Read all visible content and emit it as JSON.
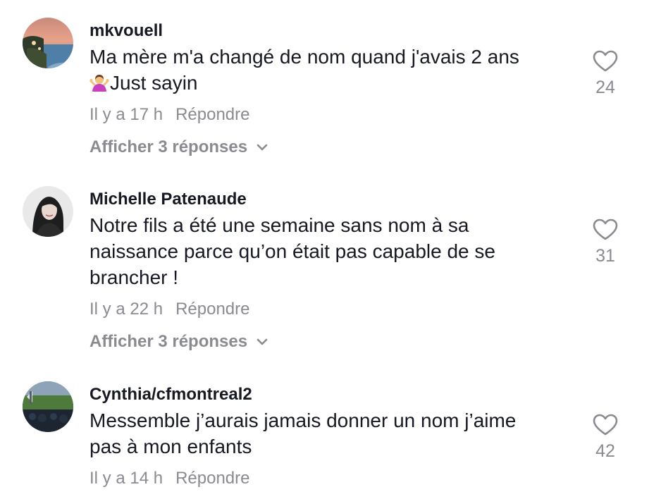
{
  "comments": [
    {
      "username": "mkvouell",
      "text_line1": "Ma mère m'a changé de nom quand j'avais 2 ans",
      "text_line2": "Just sayin",
      "emoji_icon": "person-shrugging-emoji",
      "time": "Il y a 17 h",
      "reply_label": "Répondre",
      "view_replies": "Afficher 3 réponses",
      "likes": "24"
    },
    {
      "username": "Michelle Patenaude",
      "text_line1": "Notre fils a été une semaine sans nom à sa",
      "text_line2": "naissance parce qu’on était pas capable de se",
      "text_line3": "brancher !",
      "time": "Il y a 22 h",
      "reply_label": "Répondre",
      "view_replies": "Afficher 3 réponses",
      "likes": "31"
    },
    {
      "username": "Cynthia/cfmontreal2",
      "text_line1": "Messemble j’aurais jamais donner un nom j’aime",
      "text_line2": "pas à mon enfants",
      "time": "Il y a 14 h",
      "reply_label": "Répondre",
      "likes": "42"
    }
  ],
  "colors": {
    "primary_text": "#161823",
    "secondary_text": "#8a8b91",
    "background": "#ffffff"
  }
}
